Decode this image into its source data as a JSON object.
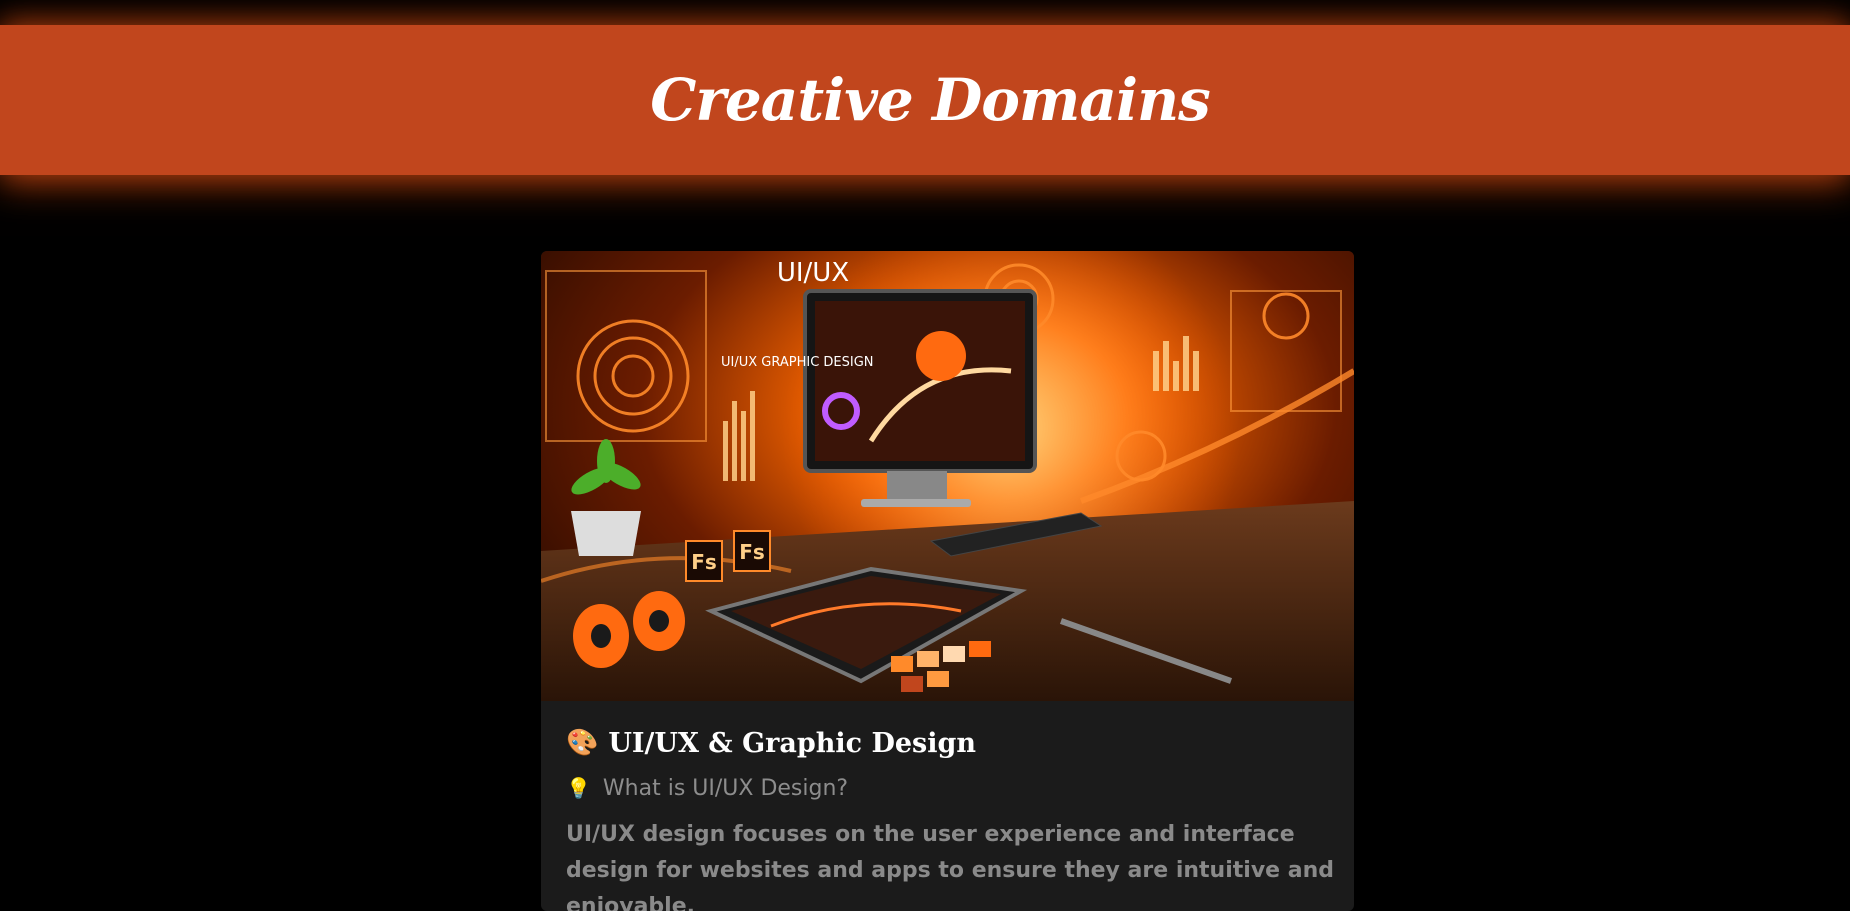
{
  "header": {
    "title": "Creative Domains"
  },
  "card": {
    "image_overlay_text": "UI/UX",
    "image_panel_text": "UI/UX GRAPHIC DESIGN",
    "image_badge_1": "Fs",
    "image_badge_2": "Fs",
    "title_icon": "palette-icon",
    "title_emoji": "🎨",
    "title": "UI/UX & Graphic Design",
    "subtitle_icon": "lightbulb-icon",
    "subtitle_emoji": "💡",
    "subtitle": "What is UI/UX Design?",
    "description": "UI/UX design focuses on the user experience and interface design for websites and apps to ensure they are intuitive and enjoyable."
  },
  "colors": {
    "header_bg": "#c1461d",
    "card_bg": "#1b1b1b",
    "page_bg": "#000000"
  }
}
